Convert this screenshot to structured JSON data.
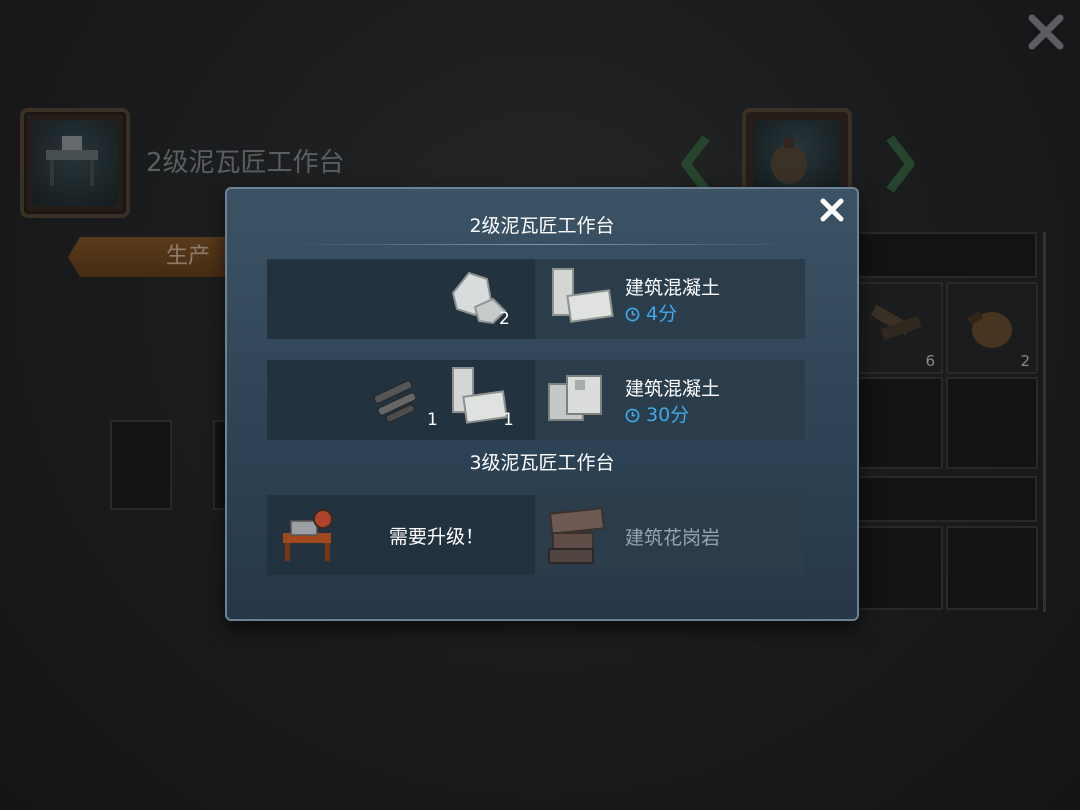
{
  "background": {
    "station_title": "2级泥瓦匠工作台",
    "tab_label": "生产",
    "inventory_counts": [
      "6",
      "2"
    ]
  },
  "dialog": {
    "section1_title": "2级泥瓦匠工作台",
    "recipes": [
      {
        "inputs": [
          {
            "icon": "stone-rubble-icon",
            "qty": "2"
          }
        ],
        "output_name": "建筑混凝土",
        "time": "4分"
      },
      {
        "inputs": [
          {
            "icon": "rebar-icon",
            "qty": "1"
          },
          {
            "icon": "concrete-blocks-icon",
            "qty": "1"
          }
        ],
        "output_name": "建筑混凝土",
        "time": "30分"
      }
    ],
    "section2_title": "3级泥瓦匠工作台",
    "locked": {
      "requirement": "需要升级！",
      "output_name": "建筑花岗岩"
    }
  },
  "colors": {
    "dialog_bg": "#2d4254",
    "time_blue": "#3fa8e6",
    "tab_orange": "#8a5a2a"
  }
}
